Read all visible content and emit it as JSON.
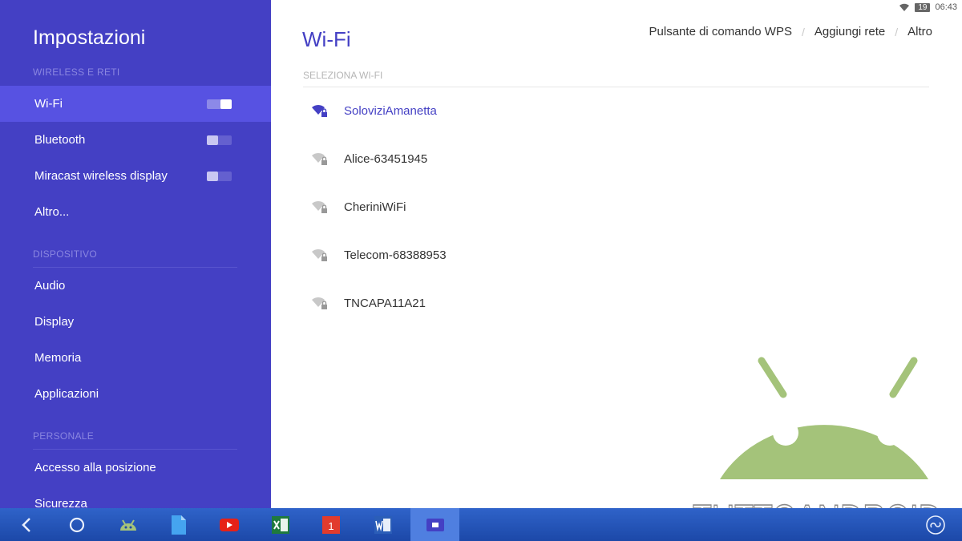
{
  "statusbar": {
    "battery": "19",
    "time": "06:43"
  },
  "sidebar": {
    "title": "Impostazioni",
    "sections": [
      {
        "header": "WIRELESS E RETI"
      },
      {
        "header": "DISPOSITIVO"
      },
      {
        "header": "PERSONALE"
      }
    ],
    "items": [
      {
        "label": "Wi-Fi",
        "toggle": "on",
        "active": true
      },
      {
        "label": "Bluetooth",
        "toggle": "off"
      },
      {
        "label": "Miracast wireless display",
        "toggle": "off"
      },
      {
        "label": "Altro..."
      },
      {
        "label": "Audio"
      },
      {
        "label": "Display"
      },
      {
        "label": "Memoria"
      },
      {
        "label": "Applicazioni"
      },
      {
        "label": "Accesso alla posizione"
      },
      {
        "label": "Sicurezza"
      }
    ]
  },
  "main": {
    "title": "Wi-Fi",
    "actions": [
      "Pulsante di comando WPS",
      "Aggiungi rete",
      "Altro"
    ],
    "select_header": "SELEZIONA WI-FI",
    "networks": [
      {
        "name": "SoloviziAmanetta",
        "connected": true,
        "icon": "wifi-locked-icon"
      },
      {
        "name": "Alice-63451945",
        "connected": false,
        "icon": "wifi-locked-icon"
      },
      {
        "name": "CheriniWiFi",
        "connected": false,
        "icon": "wifi-locked-icon"
      },
      {
        "name": "Telecom-68388953",
        "connected": false,
        "icon": "wifi-locked-icon"
      },
      {
        "name": "TNCAPA11A21",
        "connected": false,
        "icon": "wifi-locked-icon"
      }
    ]
  },
  "watermark": {
    "text": "TUTTOANDROID"
  },
  "taskbar": {
    "items": [
      "back-icon",
      "home-icon",
      "android-app-icon",
      "docs-icon",
      "youtube-icon",
      "excel-icon",
      "calendar-icon",
      "word-icon",
      "settings-app-icon",
      "floating-icon"
    ],
    "calendar_day": "1"
  },
  "colors": {
    "accent": "#4440c4",
    "sidebar_active": "#5752e2",
    "taskbar": "#2a5cc4",
    "logo_green": "#a4c37a"
  }
}
